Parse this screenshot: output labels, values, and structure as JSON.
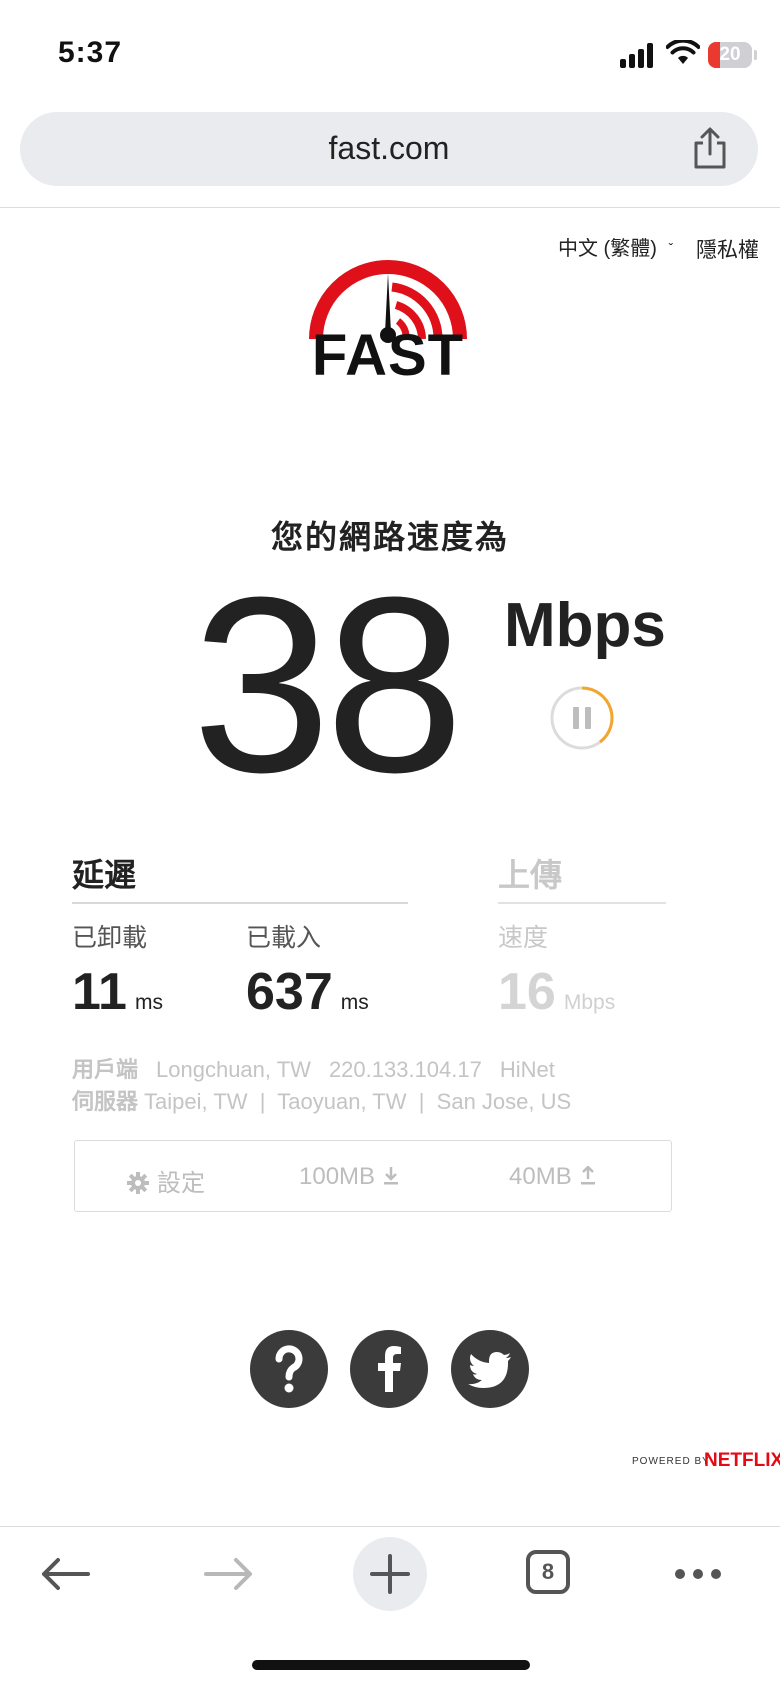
{
  "status": {
    "time": "5:37",
    "battery": "20"
  },
  "browser": {
    "url": "fast.com",
    "tab_count": "8"
  },
  "header": {
    "language": "中文 (繁體)",
    "privacy": "隱私權"
  },
  "logo": {
    "text": "FAST"
  },
  "speed": {
    "label": "您的網路速度為",
    "value": "38",
    "unit": "Mbps"
  },
  "latency": {
    "title": "延遲",
    "unloaded_label": "已卸載",
    "unloaded_value": "11",
    "unloaded_unit": "ms",
    "loaded_label": "已載入",
    "loaded_value": "637",
    "loaded_unit": "ms"
  },
  "upload": {
    "title": "上傳",
    "speed_label": "速度",
    "value": "16",
    "unit": "Mbps"
  },
  "client": {
    "label": "用戶端",
    "location": "Longchuan, TW",
    "ip": "220.133.104.17",
    "isp": "HiNet"
  },
  "servers": {
    "label": "伺服器",
    "list": "Taipei, TW  |  Taoyuan, TW  |  San Jose, US"
  },
  "settings": {
    "label": "設定",
    "download_size": "100MB",
    "upload_size": "40MB"
  },
  "footer": {
    "powered_by": "POWERED BY",
    "brand": "NETFLIX"
  },
  "colors": {
    "brand_red": "#e50914",
    "logo_red": "#e0101a",
    "pause_ring": "#f3a52c"
  }
}
